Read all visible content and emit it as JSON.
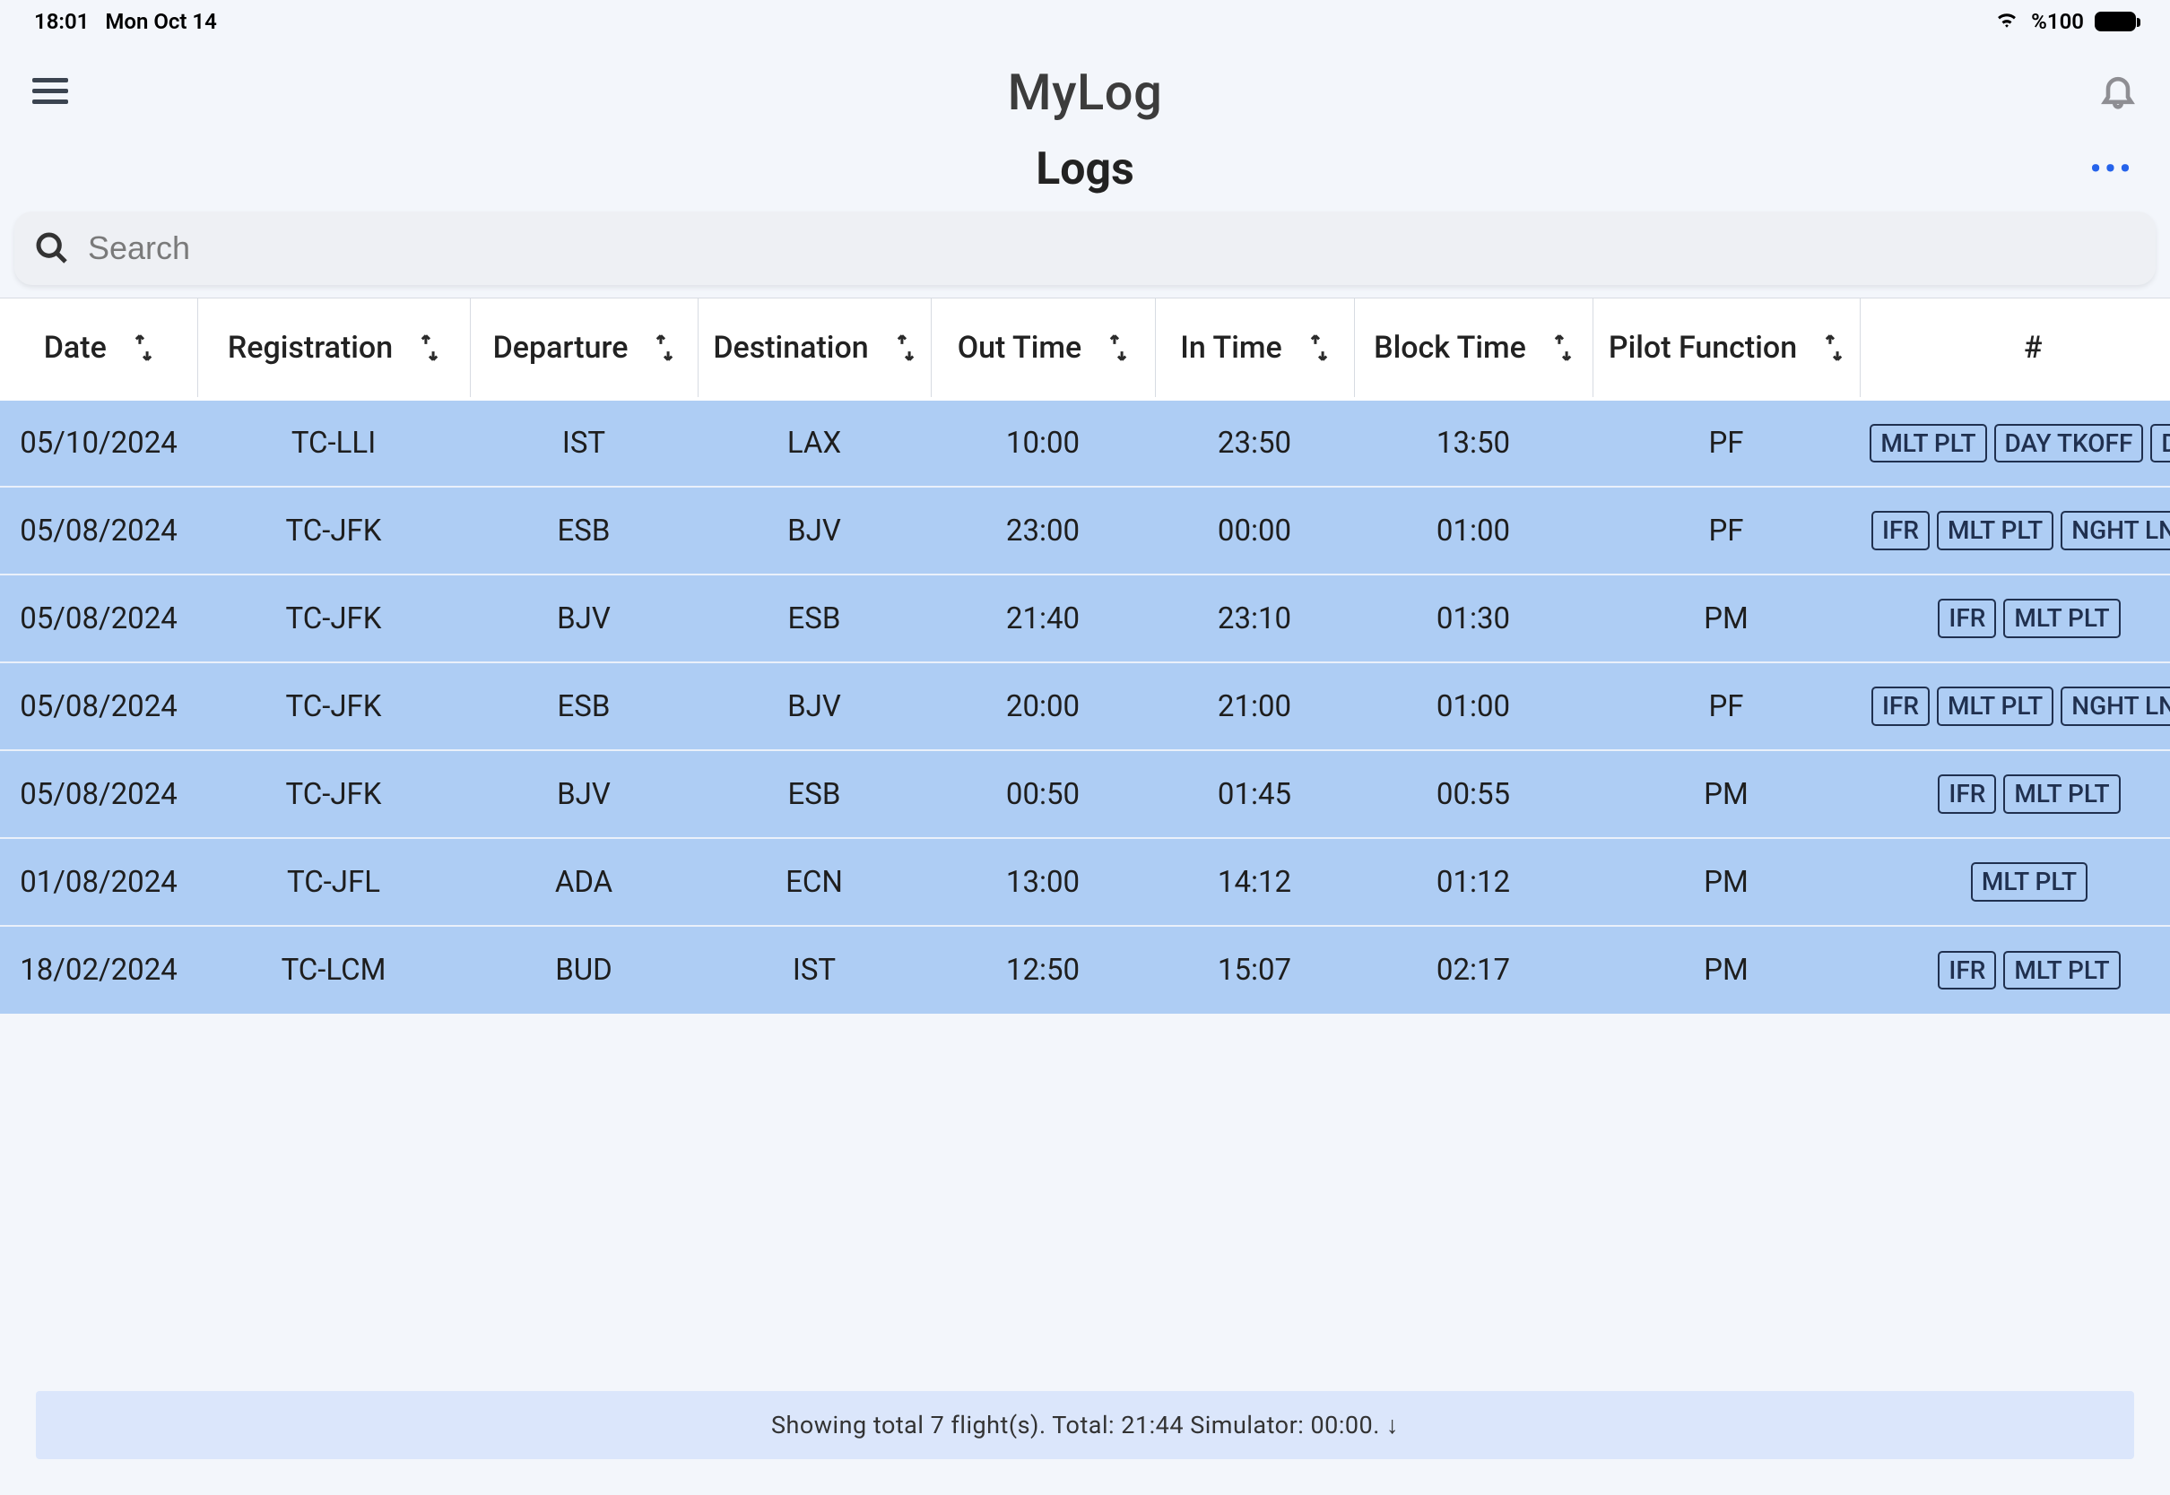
{
  "status_bar": {
    "time": "18:01",
    "date": "Mon Oct 14",
    "battery_text": "%100"
  },
  "header": {
    "app_title": "MyLog",
    "page_title": "Logs"
  },
  "search": {
    "placeholder": "Search"
  },
  "columns": [
    {
      "label": "Date",
      "sortable": true
    },
    {
      "label": "Registration",
      "sortable": true
    },
    {
      "label": "Departure",
      "sortable": true
    },
    {
      "label": "Destination",
      "sortable": true
    },
    {
      "label": "Out Time",
      "sortable": true
    },
    {
      "label": "In Time",
      "sortable": true
    },
    {
      "label": "Block Time",
      "sortable": true
    },
    {
      "label": "Pilot Function",
      "sortable": true
    },
    {
      "label": "#",
      "sortable": false
    }
  ],
  "rows": [
    {
      "date": "05/10/2024",
      "reg": "TC-LLI",
      "dep": "IST",
      "dest": "LAX",
      "out": "10:00",
      "in": "23:50",
      "block": "13:50",
      "func": "PF",
      "tags": [
        "MLT PLT",
        "DAY TKOFF",
        "D"
      ]
    },
    {
      "date": "05/08/2024",
      "reg": "TC-JFK",
      "dep": "ESB",
      "dest": "BJV",
      "out": "23:00",
      "in": "00:00",
      "block": "01:00",
      "func": "PF",
      "tags": [
        "IFR",
        "MLT PLT",
        "NGHT LN"
      ]
    },
    {
      "date": "05/08/2024",
      "reg": "TC-JFK",
      "dep": "BJV",
      "dest": "ESB",
      "out": "21:40",
      "in": "23:10",
      "block": "01:30",
      "func": "PM",
      "tags": [
        "IFR",
        "MLT PLT"
      ]
    },
    {
      "date": "05/08/2024",
      "reg": "TC-JFK",
      "dep": "ESB",
      "dest": "BJV",
      "out": "20:00",
      "in": "21:00",
      "block": "01:00",
      "func": "PF",
      "tags": [
        "IFR",
        "MLT PLT",
        "NGHT LN"
      ]
    },
    {
      "date": "05/08/2024",
      "reg": "TC-JFK",
      "dep": "BJV",
      "dest": "ESB",
      "out": "00:50",
      "in": "01:45",
      "block": "00:55",
      "func": "PM",
      "tags": [
        "IFR",
        "MLT PLT"
      ]
    },
    {
      "date": "01/08/2024",
      "reg": "TC-JFL",
      "dep": "ADA",
      "dest": "ECN",
      "out": "13:00",
      "in": "14:12",
      "block": "01:12",
      "func": "PM",
      "tags": [
        "MLT PLT"
      ]
    },
    {
      "date": "18/02/2024",
      "reg": "TC-LCM",
      "dep": "BUD",
      "dest": "IST",
      "out": "12:50",
      "in": "15:07",
      "block": "02:17",
      "func": "PM",
      "tags": [
        "IFR",
        "MLT PLT"
      ]
    }
  ],
  "summary": "Showing total 7 flight(s). Total: 21:44 Simulator: 00:00.  ↓"
}
